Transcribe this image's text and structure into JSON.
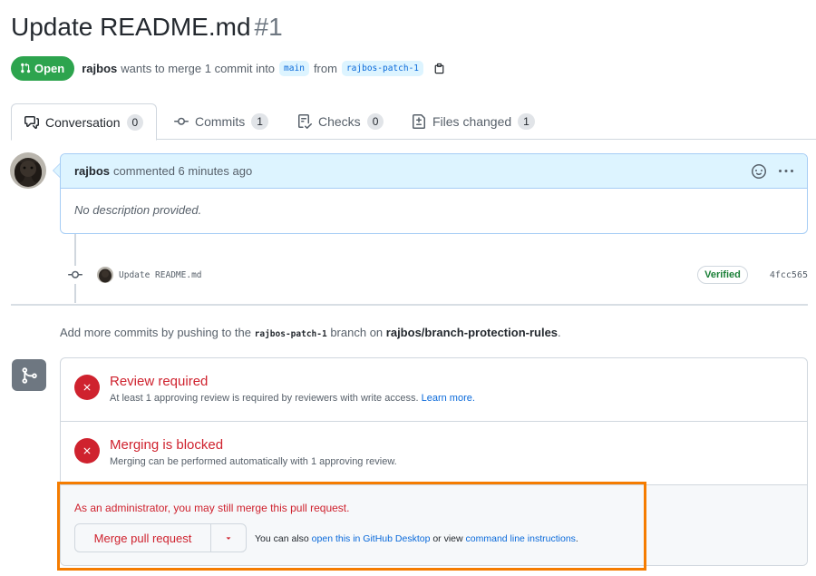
{
  "pr": {
    "title": "Update README.md",
    "number": "#1",
    "state": "Open",
    "author": "rajbos",
    "merge_text": "wants to merge 1 commit into",
    "base_branch": "main",
    "from_text": "from",
    "head_branch": "rajbos-patch-1"
  },
  "tabs": [
    {
      "label": "Conversation",
      "count": "0",
      "icon": "comment-discussion-icon"
    },
    {
      "label": "Commits",
      "count": "1",
      "icon": "git-commit-icon"
    },
    {
      "label": "Checks",
      "count": "0",
      "icon": "checklist-icon"
    },
    {
      "label": "Files changed",
      "count": "1",
      "icon": "file-diff-icon"
    }
  ],
  "comment": {
    "author": "rajbos",
    "meta": "commented 6 minutes ago",
    "body": "No description provided."
  },
  "commit": {
    "message": "Update README.md",
    "verified": "Verified",
    "sha": "4fcc565"
  },
  "hint": {
    "prefix": "Add more commits by pushing to the",
    "branch": "rajbos-patch-1",
    "middle": "branch on",
    "repo": "rajbos/branch-protection-rules",
    "suffix": "."
  },
  "checks": [
    {
      "title": "Review required",
      "desc": "At least 1 approving review is required by reviewers with write access.",
      "link": "Learn more."
    },
    {
      "title": "Merging is blocked",
      "desc": "Merging can be performed automatically with 1 approving review."
    }
  ],
  "admin": {
    "text": "As an administrator, you may still merge this pull request.",
    "merge_button": "Merge pull request",
    "also_prefix": "You can also",
    "desktop_link": "open this in GitHub Desktop",
    "or_view": "or view",
    "cli_link": "command line instructions",
    "suffix": "."
  },
  "colors": {
    "open_green": "#2da44e",
    "danger_red": "#cf222e",
    "link_blue": "#0969da",
    "highlight_orange": "#f57c00"
  }
}
